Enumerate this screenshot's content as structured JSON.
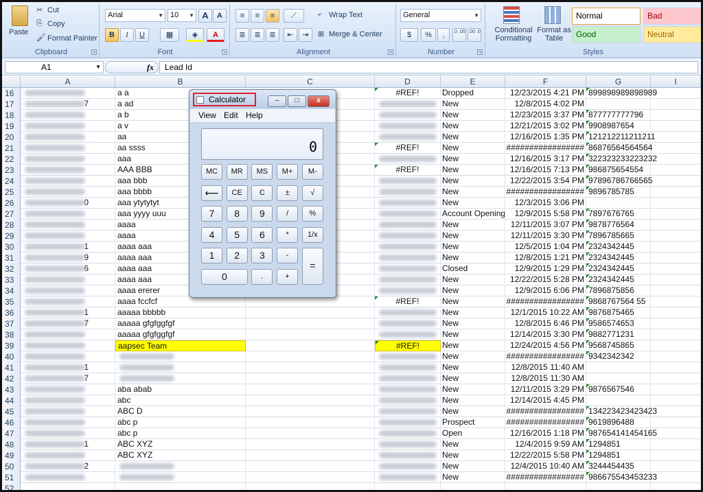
{
  "ribbon": {
    "clipboard": {
      "paste": "Paste",
      "cut": "Cut",
      "copy": "Copy",
      "format_painter": "Format Painter",
      "label": "Clipboard"
    },
    "font": {
      "name": "Arial",
      "size": "10",
      "grow": "A",
      "shrink": "A",
      "bold": "B",
      "italic": "I",
      "underline": "U",
      "label": "Font"
    },
    "alignment": {
      "wrap_text": "Wrap Text",
      "merge_center": "Merge & Center",
      "label": "Alignment"
    },
    "number": {
      "format": "General",
      "currency": "$",
      "percent": "%",
      "comma": ",",
      "inc_decimal": ".0 .00",
      "dec_decimal": ".00 .0",
      "label": "Number"
    },
    "styles": {
      "conditional_formatting": "Conditional Formatting",
      "format_as_table": "Format as Table",
      "normal": "Normal",
      "bad": "Bad",
      "good": "Good",
      "neutral": "Neutral",
      "label": "Styles"
    }
  },
  "formula_bar": {
    "name_box": "A1",
    "fx": "fx",
    "value": "Lead Id"
  },
  "columns": [
    "A",
    "B",
    "C",
    "D",
    "E",
    "F",
    "G",
    "I"
  ],
  "rows": [
    {
      "n": "16",
      "a": "",
      "b": "a a",
      "d": "#REF!",
      "e": "Dropped",
      "f": "12/23/2015 4:21 PM",
      "g": "899898989898989"
    },
    {
      "n": "17",
      "a": "7",
      "b": "a ad",
      "d": "",
      "e": "New",
      "f": "12/8/2015 4:02 PM",
      "g": ""
    },
    {
      "n": "18",
      "a": "",
      "b": "a b",
      "d": "",
      "e": "New",
      "f": "12/23/2015 3:37 PM",
      "g": "877777777796"
    },
    {
      "n": "19",
      "a": "",
      "b": "a v",
      "d": "",
      "e": "New",
      "f": "12/21/2015 3:02 PM",
      "g": "9908987654"
    },
    {
      "n": "20",
      "a": "",
      "b": "aa",
      "d": "",
      "e": "New",
      "f": "12/16/2015 1:35 PM",
      "g": "121212211211211"
    },
    {
      "n": "21",
      "a": "",
      "b": "aa ssss",
      "d": "#REF!",
      "e": "New",
      "f": "#################",
      "g": "86876564564564"
    },
    {
      "n": "22",
      "a": "",
      "b": "aaa",
      "d": "",
      "e": "New",
      "f": "12/16/2015 3:17 PM",
      "g": "322323233223232"
    },
    {
      "n": "23",
      "a": "",
      "b": "AAA BBB",
      "d": "#REF!",
      "e": "New",
      "f": "12/16/2015 7:13 PM",
      "g": "986875654554"
    },
    {
      "n": "24",
      "a": "",
      "b": "aaa bbb",
      "d": "",
      "e": "New",
      "f": "12/22/2015 3:54 PM",
      "g": "97896786766565"
    },
    {
      "n": "25",
      "a": "",
      "b": "aaa bbbb",
      "d": "",
      "e": "New",
      "f": "#################",
      "g": "9896785785"
    },
    {
      "n": "26",
      "a": "0",
      "b": "aaa ytytytyt",
      "d": "",
      "e": "New",
      "f": "12/3/2015 3:06 PM",
      "g": ""
    },
    {
      "n": "27",
      "a": "",
      "b": "aaa yyyy uuu",
      "d": "",
      "e": "Account Opening",
      "f": "12/9/2015 5:58 PM",
      "g": "7897676765"
    },
    {
      "n": "28",
      "a": "",
      "b": "aaaa",
      "d": "",
      "e": "New",
      "f": "12/11/2015 3:07 PM",
      "g": "9878776564"
    },
    {
      "n": "29",
      "a": "",
      "b": "aaaa",
      "d": "",
      "e": "New",
      "f": "12/11/2015 3:30 PM",
      "g": "7896785665"
    },
    {
      "n": "30",
      "a": "1",
      "b": "aaaa aaa",
      "d": "",
      "e": "New",
      "f": "12/5/2015 1:04 PM",
      "g": "2324342445"
    },
    {
      "n": "31",
      "a": "9",
      "b": "aaaa aaa",
      "d": "",
      "e": "New",
      "f": "12/8/2015 1:21 PM",
      "g": "2324342445"
    },
    {
      "n": "32",
      "a": "6",
      "b": "aaaa aaa",
      "d": "",
      "e": "Closed",
      "f": "12/9/2015 1:29 PM",
      "g": "2324342445"
    },
    {
      "n": "33",
      "a": "",
      "b": "aaaa aaa",
      "d": "",
      "e": "New",
      "f": "12/22/2015 5:28 PM",
      "g": "2324342445"
    },
    {
      "n": "34",
      "a": "",
      "b": "aaaa ererer",
      "d": "",
      "e": "New",
      "f": "12/9/2015 6:06 PM",
      "g": "7896875856"
    },
    {
      "n": "35",
      "a": "",
      "b": "aaaa fccfcf",
      "d": "#REF!",
      "e": "New",
      "f": "#################",
      "g": "9868767564 55"
    },
    {
      "n": "36",
      "a": "1",
      "b": "aaaaa bbbbb",
      "d": "",
      "e": "New",
      "f": "12/1/2015 10:22 AM",
      "g": "9876875465"
    },
    {
      "n": "37",
      "a": "7",
      "b": "aaaaa gfgfggfgf",
      "d": "",
      "e": "New",
      "f": "12/8/2015 6:46 PM",
      "g": "9586574653"
    },
    {
      "n": "38",
      "a": "",
      "b": "aaaaa gfgfggfgf",
      "d": "",
      "e": "New",
      "f": "12/14/2015 3:30 PM",
      "g": "9882771231"
    },
    {
      "n": "39",
      "a": "",
      "b": "aapsec Team",
      "d": "#REF!",
      "e": "New",
      "f": "12/24/2015 4:56 PM",
      "g": "9568745865"
    },
    {
      "n": "40",
      "a": "",
      "b": "",
      "d": "",
      "e": "New",
      "f": "#################",
      "g": "9342342342"
    },
    {
      "n": "41",
      "a": "1",
      "b": "",
      "d": "",
      "e": "New",
      "f": "12/8/2015 11:40 AM",
      "g": ""
    },
    {
      "n": "42",
      "a": "7",
      "b": "",
      "d": "",
      "e": "New",
      "f": "12/8/2015 11:30 AM",
      "g": ""
    },
    {
      "n": "43",
      "a": "",
      "b": "aba abab",
      "d": "",
      "e": "New",
      "f": "12/11/2015 3:29 PM",
      "g": "9876567546"
    },
    {
      "n": "44",
      "a": "",
      "b": "abc",
      "d": "",
      "e": "New",
      "f": "12/14/2015 4:45 PM",
      "g": ""
    },
    {
      "n": "45",
      "a": "",
      "b": "ABC D",
      "d": "",
      "e": "New",
      "f": "#################",
      "g": "134223423423423"
    },
    {
      "n": "46",
      "a": "",
      "b": "abc p",
      "d": "",
      "e": "Prospect",
      "f": "#################",
      "g": "9619896488"
    },
    {
      "n": "47",
      "a": "",
      "b": "abc p",
      "d": "",
      "e": "Open",
      "f": "12/16/2015 1:18 PM",
      "g": "987654141454165"
    },
    {
      "n": "48",
      "a": "1",
      "b": "ABC XYZ",
      "d": "",
      "e": "New",
      "f": "12/4/2015 9:59 AM",
      "g": "1294851"
    },
    {
      "n": "49",
      "a": "",
      "b": "ABC XYZ",
      "d": "",
      "e": "New",
      "f": "12/22/2015 5:58 PM",
      "g": "1294851"
    },
    {
      "n": "50",
      "a": "2",
      "b": "",
      "d": "",
      "e": "New",
      "f": "12/4/2015 10:40 AM",
      "g": "3244454435"
    },
    {
      "n": "51",
      "a": "",
      "b": "",
      "d": "",
      "e": "New",
      "f": "#################",
      "g": "986675543453233"
    },
    {
      "n": "52",
      "a": "",
      "b": "",
      "d": "",
      "e": "",
      "f": "",
      "g": ""
    }
  ],
  "calculator": {
    "title": "Calculator",
    "minimize": "–",
    "maximize": "□",
    "close": "x",
    "menu": [
      "View",
      "Edit",
      "Help"
    ],
    "display": "0",
    "keys": [
      {
        "l": "MC",
        "r": 0,
        "c": 0
      },
      {
        "l": "MR",
        "r": 0,
        "c": 1
      },
      {
        "l": "MS",
        "r": 0,
        "c": 2
      },
      {
        "l": "M+",
        "r": 0,
        "c": 3
      },
      {
        "l": "M-",
        "r": 0,
        "c": 4
      },
      {
        "l": "⟵",
        "r": 1,
        "c": 0
      },
      {
        "l": "CE",
        "r": 1,
        "c": 1
      },
      {
        "l": "C",
        "r": 1,
        "c": 2
      },
      {
        "l": "±",
        "r": 1,
        "c": 3
      },
      {
        "l": "√",
        "r": 1,
        "c": 4
      },
      {
        "l": "7",
        "r": 2,
        "c": 0
      },
      {
        "l": "8",
        "r": 2,
        "c": 1
      },
      {
        "l": "9",
        "r": 2,
        "c": 2
      },
      {
        "l": "/",
        "r": 2,
        "c": 3
      },
      {
        "l": "%",
        "r": 2,
        "c": 4
      },
      {
        "l": "4",
        "r": 3,
        "c": 0
      },
      {
        "l": "5",
        "r": 3,
        "c": 1
      },
      {
        "l": "6",
        "r": 3,
        "c": 2
      },
      {
        "l": "*",
        "r": 3,
        "c": 3
      },
      {
        "l": "1/x",
        "r": 3,
        "c": 4
      },
      {
        "l": "1",
        "r": 4,
        "c": 0
      },
      {
        "l": "2",
        "r": 4,
        "c": 1
      },
      {
        "l": "3",
        "r": 4,
        "c": 2
      },
      {
        "l": "-",
        "r": 4,
        "c": 3
      },
      {
        "l": "=",
        "r": 4,
        "c": 4,
        "tall": true
      },
      {
        "l": "0",
        "r": 5,
        "c": 0,
        "wide": true
      },
      {
        "l": ".",
        "r": 5,
        "c": 2
      },
      {
        "l": "+",
        "r": 5,
        "c": 3
      }
    ]
  }
}
